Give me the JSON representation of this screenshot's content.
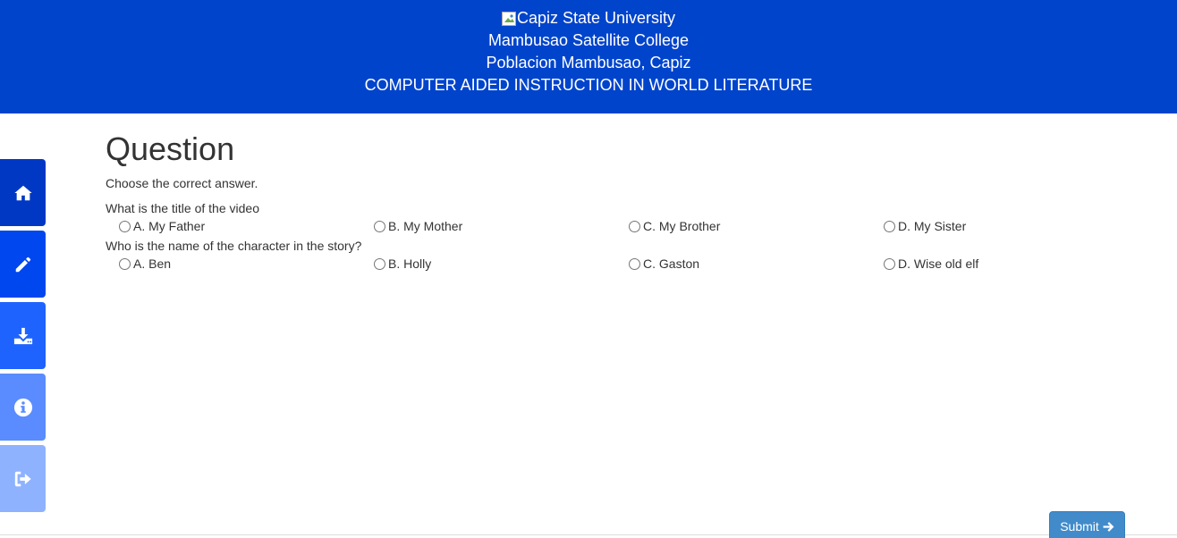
{
  "header": {
    "university": "Capiz State University",
    "college": "Mambusao Satellite College",
    "address": "Poblacion Mambusao, Capiz",
    "course": "COMPUTER AIDED INSTRUCTION IN WORLD LITERATURE",
    "logo_icon": "broken-image-icon"
  },
  "sidebar": {
    "items": [
      {
        "icon": "home-icon",
        "color": "#0038c4"
      },
      {
        "icon": "pencil-icon",
        "color": "#0047f0"
      },
      {
        "icon": "download-icon",
        "color": "#1f63ff"
      },
      {
        "icon": "info-icon",
        "color": "#5a8cff"
      },
      {
        "icon": "sign-out-icon",
        "color": "#8fb2ff"
      }
    ]
  },
  "main": {
    "title": "Question",
    "instruction": "Choose the correct answer.",
    "questions": [
      {
        "text": "What is the title of the video",
        "options": [
          "A. My Father",
          "B. My Mother",
          "C. My Brother",
          "D. My Sister"
        ]
      },
      {
        "text": "Who is the name of the character in the story?",
        "options": [
          "A. Ben",
          "B. Holly",
          "C. Gaston",
          "D. Wise old elf"
        ]
      }
    ]
  },
  "submit": {
    "label": "Submit",
    "icon": "arrow-right-icon",
    "color": "#428bca"
  }
}
